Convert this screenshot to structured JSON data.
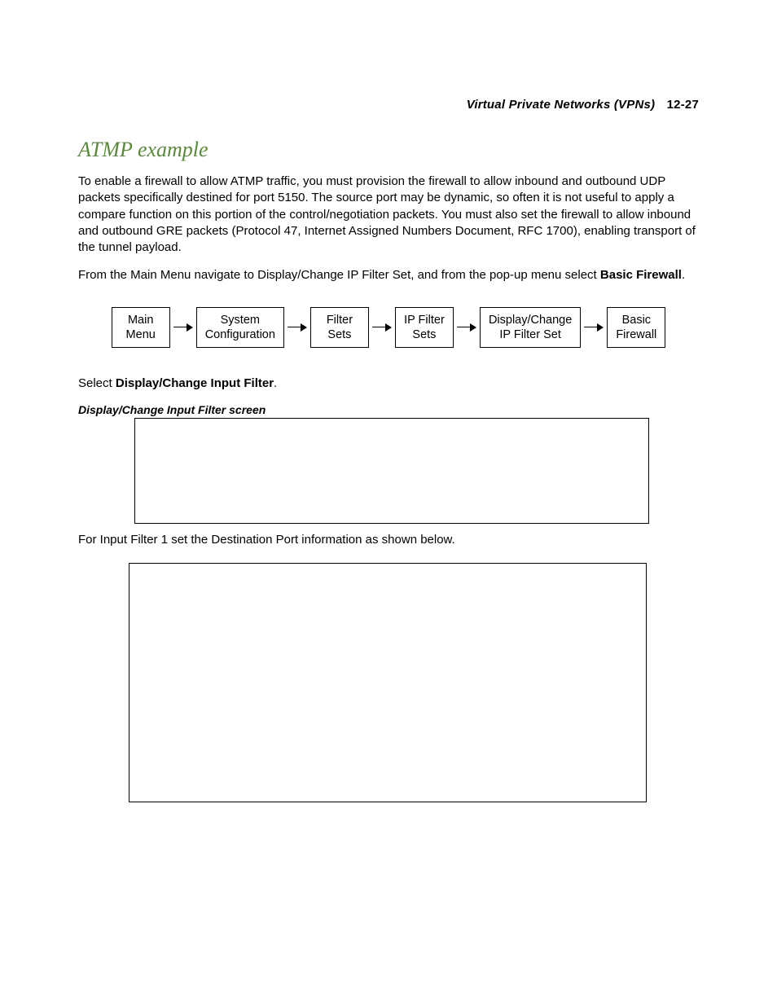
{
  "header": {
    "title": "Virtual Private Networks (VPNs)",
    "page": "12-27"
  },
  "section": {
    "title": "ATMP example"
  },
  "paragraphs": {
    "p1": "To enable a firewall to allow ATMP traffic, you must provision the firewall to allow inbound and outbound UDP packets specifically destined for port 5150. The source port may be dynamic, so often it is not useful to apply a compare function on this portion of the control/negotiation packets. You must also set the firewall to allow inbound and outbound GRE packets (Protocol 47, Internet Assigned Numbers Document, RFC 1700), enabling transport of the tunnel payload.",
    "p2_pre": "From the Main Menu navigate to Display/Change IP Filter Set, and from the pop-up menu select ",
    "p2_bold": "Basic Firewall",
    "p2_post": ".",
    "p3_pre": "Select ",
    "p3_bold": "Display/Change Input Filter",
    "p3_post": ".",
    "caption1": "Display/Change Input Filter screen",
    "p4": "For Input Filter 1 set the Destination Port information as shown below."
  },
  "flow": {
    "b1a": "Main",
    "b1b": "Menu",
    "b2a": "System",
    "b2b": "Configuration",
    "b3a": "Filter",
    "b3b": "Sets",
    "b4a": "IP Filter",
    "b4b": "Sets",
    "b5a": "Display/Change",
    "b5b": "IP Filter Set",
    "b6a": "Basic",
    "b6b": "Firewall"
  }
}
